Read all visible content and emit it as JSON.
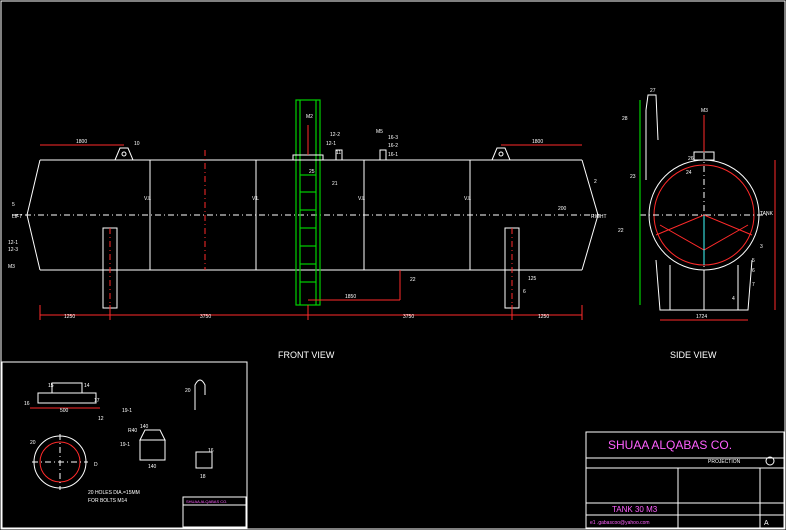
{
  "front_view": {
    "title": "FRONT VIEW",
    "dims": {
      "d1250a": "1250",
      "d3750a": "3750",
      "d3750b": "3750",
      "d1250b": "1250",
      "d1850": "1850",
      "d1800a": "1800",
      "d1800b": "1800",
      "d200": "200"
    },
    "labels": {
      "lift": "LIFT",
      "right": "RIGHT",
      "n10": "10",
      "n2": "2",
      "n21": "21",
      "n22": "22",
      "n23": "23",
      "n25": "25",
      "n6": "6",
      "n125": "125",
      "n12_1": "12-1",
      "n12_2": "12-2",
      "n12_3": "12-3",
      "m3": "M3",
      "m2": "M2",
      "n12_2b": "12-2",
      "n12_1b": "12-1",
      "n11": "11",
      "m5": "M5",
      "n16_3": "16-3",
      "n16_2": "16-2",
      "n16_1": "16-1",
      "vl": "V.L",
      "n5": "5"
    }
  },
  "side_view": {
    "title": "SIDE VIEW",
    "labels": {
      "n27": "27",
      "n28": "28",
      "n26": "26",
      "n23": "23",
      "n24": "24",
      "n22": "22",
      "m3": "M3",
      "n3": "3",
      "n5": "5",
      "n6": "6",
      "n4": "4",
      "n7": "7",
      "n1724": "1724",
      "n2076": "2076",
      "n1734": "1734",
      "n6in": "6",
      "tank_label": "TANK"
    }
  },
  "details": {
    "labels": {
      "n15": "15",
      "n14": "14",
      "n16": "16",
      "n12": "12",
      "n17": "17",
      "n500": "500",
      "n20": "20",
      "d": "D",
      "holes": "20 HOLES DIA.=15MM",
      "bolts": "FOR BOLTS M14",
      "n19_1": "19-1",
      "n19_1b": "19-1",
      "r40": "R40",
      "n140": "140",
      "n140b": "140",
      "n18": "18",
      "n20b": "20"
    }
  },
  "title_block": {
    "company": "SHUAA ALQABAS CO.",
    "projection": "PROJECTION",
    "tank_title": "TANK 30 M3",
    "email": "e1 .gabascoo@yahoo.com",
    "sheet": "A",
    "small_company": "SHUAA ALQABAS CO."
  }
}
